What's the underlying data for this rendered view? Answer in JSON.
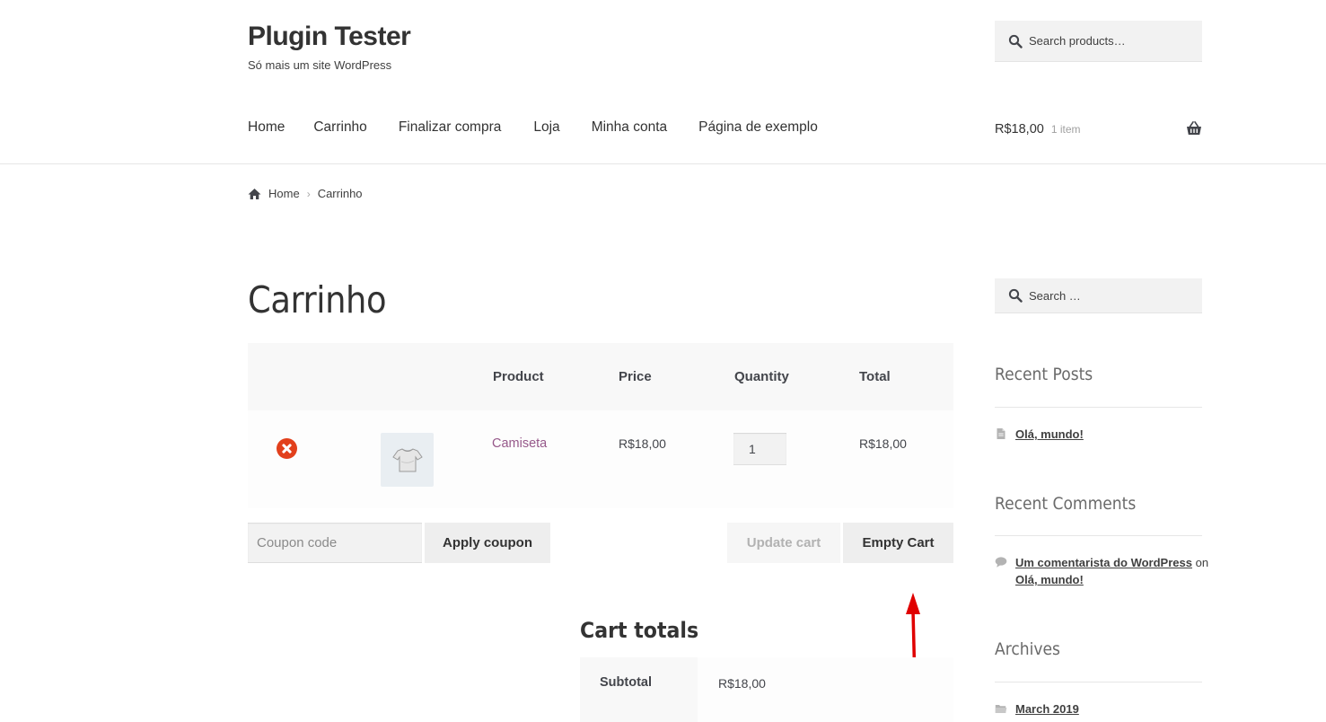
{
  "site": {
    "title": "Plugin Tester",
    "tagline": "Só mais um site WordPress"
  },
  "header_search": {
    "placeholder": "Search products…"
  },
  "nav": {
    "items": [
      "Home",
      "Carrinho",
      "Finalizar compra",
      "Loja",
      "Minha conta",
      "Página de exemplo"
    ]
  },
  "mini_cart": {
    "amount": "R$18,00",
    "count": "1 item",
    "icon": "basket-icon"
  },
  "breadcrumb": {
    "home": "Home",
    "current": "Carrinho"
  },
  "page": {
    "title": "Carrinho"
  },
  "cart_table": {
    "headers": {
      "product": "Product",
      "price": "Price",
      "quantity": "Quantity",
      "total": "Total"
    },
    "rows": [
      {
        "name": "Camiseta",
        "price": "R$18,00",
        "quantity": "1",
        "total": "R$18,00",
        "thumbnail": "tshirt-icon"
      }
    ]
  },
  "actions": {
    "coupon_placeholder": "Coupon code",
    "apply_coupon": "Apply coupon",
    "update_cart": "Update cart",
    "empty_cart": "Empty Cart"
  },
  "annotation": {
    "arrow_color": "#e00000",
    "icon": "up-arrow-icon"
  },
  "cart_totals": {
    "title": "Cart totals",
    "subtotal_label": "Subtotal",
    "subtotal_value": "R$18,00"
  },
  "sidebar": {
    "search_placeholder": "Search …",
    "recent_posts": {
      "title": "Recent Posts",
      "items": [
        "Olá, mundo!"
      ]
    },
    "recent_comments": {
      "title": "Recent Comments",
      "items": [
        {
          "author": "Um comentarista do WordPress",
          "on": "on",
          "post": "Olá, mundo!"
        }
      ]
    },
    "archives": {
      "title": "Archives",
      "items": [
        "March 2019"
      ]
    }
  },
  "colors": {
    "link_purple": "#96588a",
    "remove_red": "#e2401c",
    "text": "#43454b",
    "button_bg": "#eeeeee"
  }
}
